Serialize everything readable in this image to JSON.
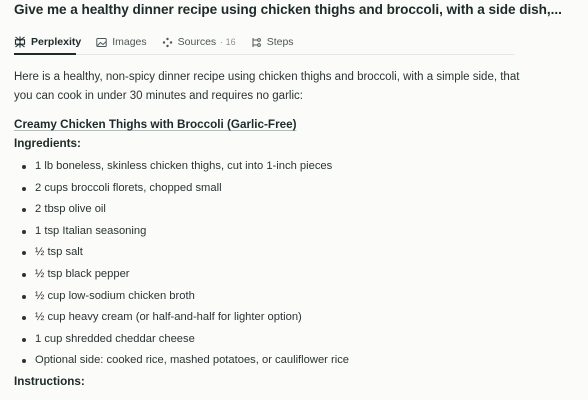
{
  "query": {
    "title": "Give me a healthy dinner recipe using chicken thighs and broccoli, with a side dish,..."
  },
  "tabs": [
    {
      "label": "Perplexity",
      "icon": "perplexity-logo-icon",
      "active": true
    },
    {
      "label": "Images",
      "icon": "image-icon",
      "active": false
    },
    {
      "label": "Sources",
      "icon": "sources-icon",
      "count": "16",
      "active": false
    },
    {
      "label": "Steps",
      "icon": "steps-icon",
      "active": false
    }
  ],
  "answer": {
    "intro": "Here is a healthy, non-spicy dinner recipe using chicken thighs and broccoli, with a simple side, that you can cook in under 30 minutes and requires no garlic:",
    "recipe_title": "Creamy Chicken Thighs with Broccoli (Garlic-Free)",
    "ingredients_heading": "Ingredients:",
    "ingredients": [
      "1 lb boneless, skinless chicken thighs, cut into 1-inch pieces",
      "2 cups broccoli florets, chopped small",
      "2 tbsp olive oil",
      "1 tsp Italian seasoning",
      "½ tsp salt",
      "½ tsp black pepper",
      "½ cup low-sodium chicken broth",
      "½ cup heavy cream (or half-and-half for lighter option)",
      "1 cup shredded cheddar cheese",
      "Optional side: cooked rice, mashed potatoes, or cauliflower rice"
    ],
    "instructions_heading": "Instructions:"
  },
  "colors": {
    "background": "#fbfbf9",
    "text": "#1d2a2a",
    "muted": "#4d5757"
  }
}
